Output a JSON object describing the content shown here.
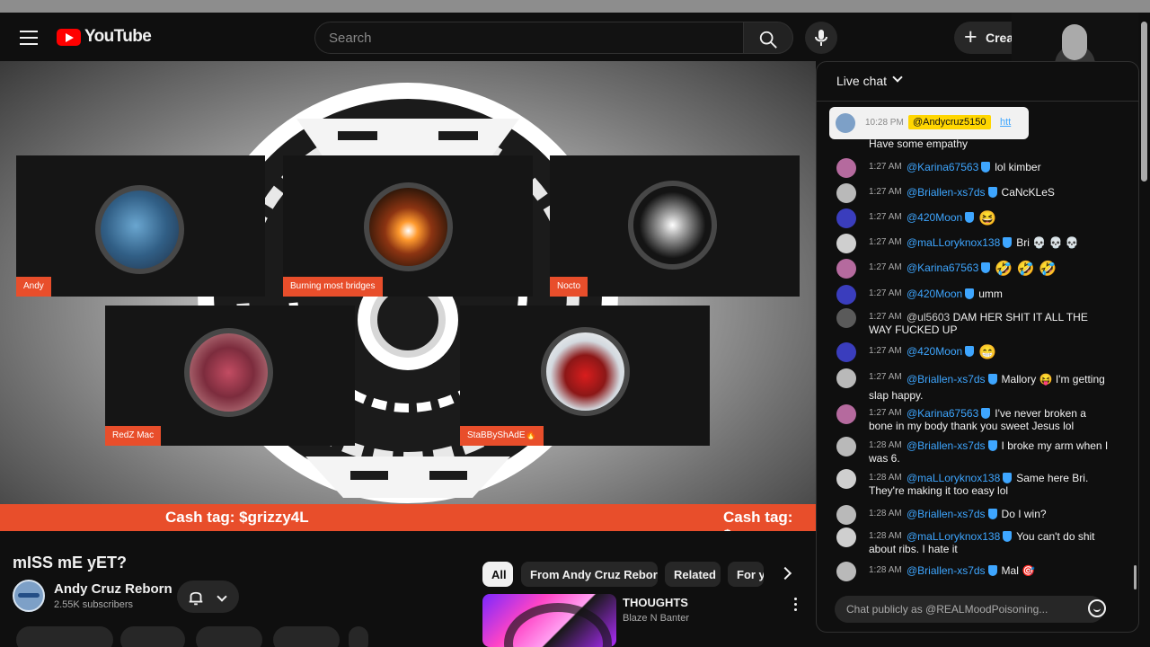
{
  "header": {
    "logo_text": "YouTube",
    "search_placeholder": "Search",
    "create_label": "Creat"
  },
  "player": {
    "participants": [
      {
        "name": "Andy"
      },
      {
        "name": "Burning most bridges"
      },
      {
        "name": "Nocto"
      },
      {
        "name": "RedZ Mac"
      },
      {
        "name": "StaBByShAdE🔥"
      }
    ],
    "ticker_text": "Cash tag: $grizzy4L",
    "ticker_text_repeat": "Cash tag: $gr"
  },
  "video": {
    "title": "mISS mE yET?",
    "channel_name": "Andy Cruz  Reborn",
    "subscribers": "2.55K subscribers"
  },
  "related": {
    "chips": [
      "All",
      "From Andy Cruz Reborn",
      "Related",
      "For y"
    ],
    "first_video": {
      "title": "THOUGHTS",
      "channel": "Blaze N Banter"
    }
  },
  "chat": {
    "header_label": "Live chat",
    "pinned": {
      "time": "10:28 PM",
      "user": "@Andycruz5150",
      "link": "htt"
    },
    "partial_message": "Have some empathy",
    "messages": [
      {
        "time": "1:27 AM",
        "user": "@Karina67563",
        "text": "lol kimber"
      },
      {
        "time": "1:27 AM",
        "user": "@Briallen-xs7ds",
        "text": "CaNcKLeS"
      },
      {
        "time": "1:27 AM",
        "user": "@420Moon",
        "text": "😆"
      },
      {
        "time": "1:27 AM",
        "user": "@maLLoryknox138",
        "text": "Bri 💀 💀 💀"
      },
      {
        "time": "1:27 AM",
        "user": "@Karina67563",
        "text": "🤣 🤣 🤣"
      },
      {
        "time": "1:27 AM",
        "user": "@420Moon",
        "text": "umm"
      },
      {
        "time": "1:27 AM",
        "user": "@ul5603",
        "text": "DAM HER SHIT IT ALL THE WAY FUCKED UP"
      },
      {
        "time": "1:27 AM",
        "user": "@420Moon",
        "text": "😁"
      },
      {
        "time": "1:27 AM",
        "user": "@Briallen-xs7ds",
        "text": "Mallory 😝 I'm getting slap happy."
      },
      {
        "time": "1:27 AM",
        "user": "@Karina67563",
        "text": "I've never broken a bone in my body thank you sweet Jesus lol"
      },
      {
        "time": "1:28 AM",
        "user": "@Briallen-xs7ds",
        "text": "I broke my arm when I was 6."
      },
      {
        "time": "1:28 AM",
        "user": "@maLLoryknox138",
        "text": "Same here Bri. They're making it too easy lol"
      },
      {
        "time": "1:28 AM",
        "user": "@Briallen-xs7ds",
        "text": "Do I win?"
      },
      {
        "time": "1:28 AM",
        "user": "@maLLoryknox138",
        "text": "You can't do shit about ribs. I hate it"
      },
      {
        "time": "1:28 AM",
        "user": "@Briallen-xs7ds",
        "text": "Mal 🎯"
      }
    ],
    "input_placeholder": "Chat publicly as @REALMoodPoisoning..."
  },
  "colors": {
    "background": "#0f0f0f",
    "youtube_red": "#ff0000",
    "accent_blue": "#3ea6ff",
    "label_orange": "#e84e2b",
    "pinned_highlight": "#ffd600"
  },
  "icons": [
    "menu-icon",
    "youtube-logo-icon",
    "search-icon",
    "microphone-icon",
    "plus-icon",
    "chevron-down-icon",
    "bell-icon",
    "chevron-right-icon",
    "more-vert-icon",
    "emoji-icon",
    "verified-shield-icon"
  ]
}
